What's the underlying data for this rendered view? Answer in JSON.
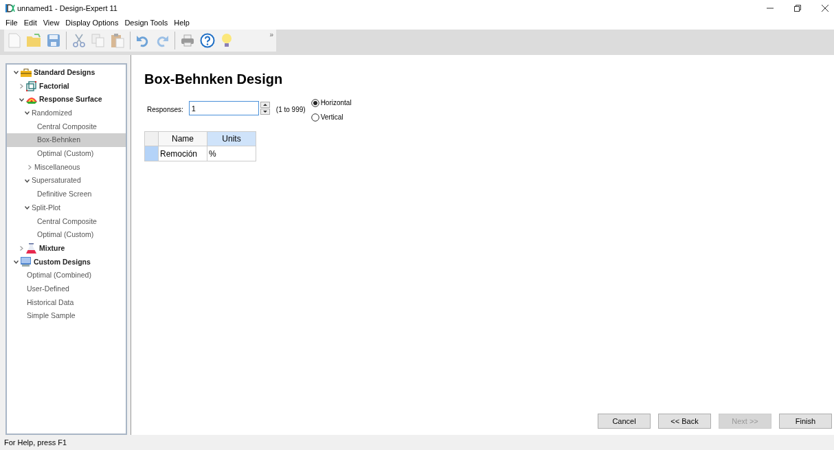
{
  "window": {
    "title": "unnamed1 - Design-Expert 11"
  },
  "menu": [
    "File",
    "Edit",
    "View",
    "Display Options",
    "Design Tools",
    "Help"
  ],
  "toolbar": {
    "overflow": "»"
  },
  "tree": [
    {
      "label": "Standard Designs",
      "kind": "toolbox",
      "expanded": true,
      "selected": false,
      "children": [
        {
          "label": "Factorial",
          "kind": "cube",
          "expanded": false,
          "selected": false
        },
        {
          "label": "Response Surface",
          "kind": "surface",
          "expanded": true,
          "selected": false,
          "children": [
            {
              "label": "Randomized",
              "kind": "group",
              "expanded": true,
              "selected": false,
              "children": [
                {
                  "label": "Central Composite",
                  "kind": "design",
                  "selected": false
                },
                {
                  "label": "Box-Behnken",
                  "kind": "design",
                  "selected": true
                },
                {
                  "label": "Optimal (Custom)",
                  "kind": "design",
                  "selected": false
                },
                {
                  "label": "Miscellaneous",
                  "kind": "design",
                  "expanded": false,
                  "selected": false
                }
              ]
            },
            {
              "label": "Supersaturated",
              "kind": "group",
              "expanded": true,
              "selected": false,
              "children": [
                {
                  "label": "Definitive Screen",
                  "kind": "design",
                  "selected": false
                }
              ]
            },
            {
              "label": "Split-Plot",
              "kind": "group",
              "expanded": true,
              "selected": false,
              "children": [
                {
                  "label": "Central Composite",
                  "kind": "design",
                  "selected": false
                },
                {
                  "label": "Optimal (Custom)",
                  "kind": "design",
                  "selected": false
                }
              ]
            }
          ]
        },
        {
          "label": "Mixture",
          "kind": "flask",
          "expanded": false,
          "selected": false
        }
      ]
    },
    {
      "label": "Custom Designs",
      "kind": "monitor",
      "expanded": true,
      "selected": false,
      "children": [
        {
          "label": "Optimal (Combined)",
          "kind": "design",
          "selected": false
        },
        {
          "label": "User-Defined",
          "kind": "design",
          "selected": false
        },
        {
          "label": "Historical Data",
          "kind": "design",
          "selected": false
        },
        {
          "label": "Simple Sample",
          "kind": "design",
          "selected": false
        }
      ]
    }
  ],
  "main": {
    "heading": "Box-Behnken Design",
    "responses_label": "Responses:",
    "responses_value": "1",
    "range": "(1 to 999)",
    "layout_options": [
      {
        "label": "Horizontal",
        "selected": true
      },
      {
        "label": "Vertical",
        "selected": false
      }
    ],
    "table": {
      "columns": [
        {
          "label": "Name",
          "selected": false
        },
        {
          "label": "Units",
          "selected": true
        }
      ],
      "rows": [
        [
          "Remoción",
          "%"
        ]
      ]
    }
  },
  "buttons": [
    {
      "label": "Cancel",
      "disabled": false
    },
    {
      "label": "<< Back",
      "disabled": false
    },
    {
      "label": "Next >>",
      "disabled": true
    },
    {
      "label": "Finish",
      "disabled": false
    }
  ],
  "status_bar": "For Help, press F1"
}
